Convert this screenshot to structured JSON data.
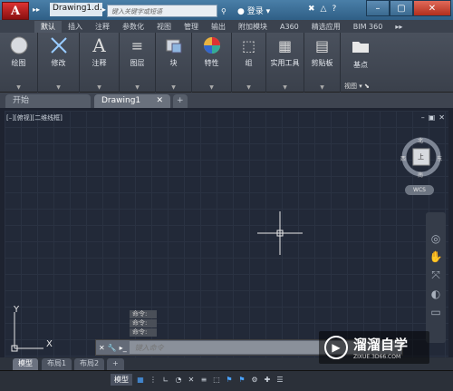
{
  "app": {
    "logo": "A",
    "document_title": "Drawing1.d...",
    "search_placeholder": "键入关键字或短语",
    "login_label": "登录"
  },
  "ribbon_tabs": [
    "默认",
    "插入",
    "注释",
    "参数化",
    "视图",
    "管理",
    "输出",
    "附加模块",
    "A360",
    "精选应用",
    "BIM 360",
    "▸▸"
  ],
  "ribbon_panels": [
    {
      "label": "绘图",
      "icon": "draw-icon"
    },
    {
      "label": "修改",
      "icon": "modify-icon"
    },
    {
      "label": "注释",
      "icon": "annotation-icon"
    },
    {
      "label": "图层",
      "icon": "layer-icon"
    },
    {
      "label": "块",
      "icon": "block-icon"
    },
    {
      "label": "特性",
      "icon": "properties-icon"
    },
    {
      "label": "组",
      "icon": "group-icon"
    },
    {
      "label": "实用工具",
      "icon": "utilities-icon"
    },
    {
      "label": "剪贴板",
      "icon": "clipboard-icon"
    },
    {
      "label": "基点",
      "icon": "basepoint-icon"
    }
  ],
  "view_label": "视图",
  "doc_tabs": {
    "start": "开始",
    "drawing": "Drawing1"
  },
  "viewport_label": "[–][俯视][二维线框]",
  "viewcube": {
    "north": "北",
    "south": "南",
    "west": "西",
    "east": "东",
    "top": "上",
    "wcs": "WCS"
  },
  "ucs": {
    "x": "X",
    "y": "Y"
  },
  "command": {
    "history": [
      "命令:",
      "命令:",
      "命令:"
    ],
    "placeholder": "键入命令"
  },
  "layout_tabs": [
    "模型",
    "布局1",
    "布局2"
  ],
  "status": {
    "model": "模型"
  },
  "watermark": {
    "name": "溜溜自学",
    "url": "ZIXUE.3D66.COM"
  }
}
